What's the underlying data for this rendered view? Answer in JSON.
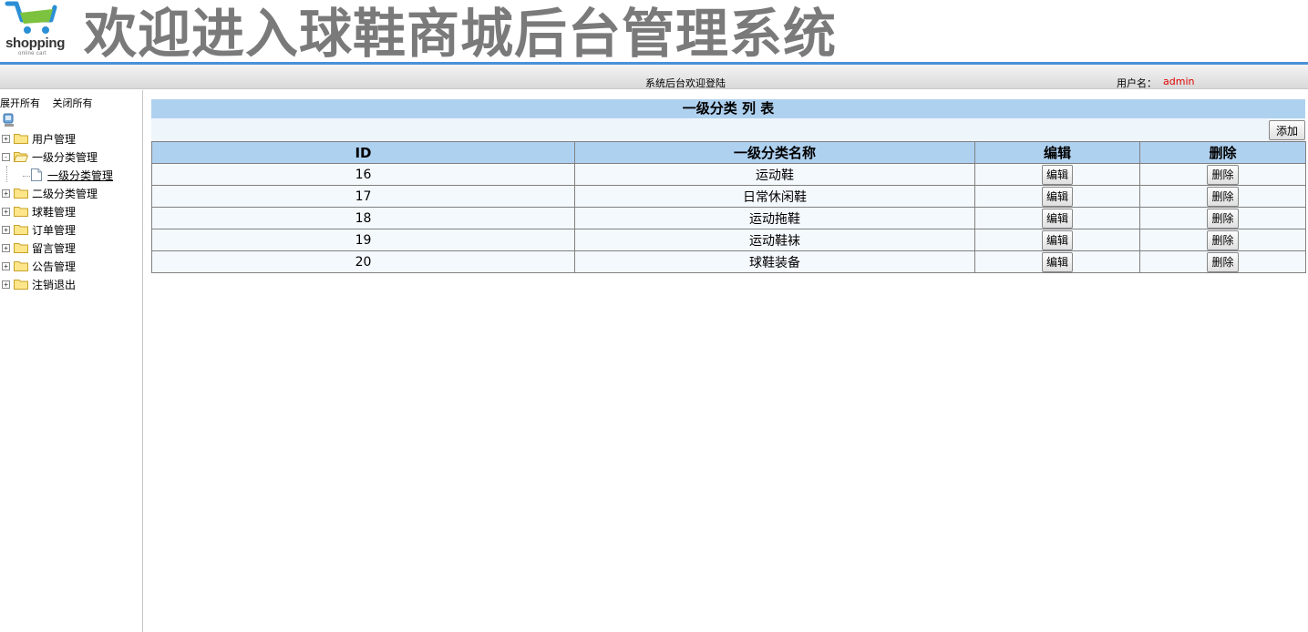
{
  "header": {
    "logo_word": "shopping",
    "logo_sub": "online cart",
    "title": "欢迎进入球鞋商城后台管理系统"
  },
  "statusbar": {
    "welcome": "系统后台欢迎登陆",
    "user_label": "用户名：",
    "user_value": "admin"
  },
  "sidebar": {
    "expand_all": "展开所有",
    "collapse_all": "关闭所有",
    "items": [
      {
        "label": "用户管理",
        "toggle": "+"
      },
      {
        "label": "一级分类管理",
        "toggle": "-"
      },
      {
        "label": "一级分类管理"
      },
      {
        "label": "二级分类管理",
        "toggle": "+"
      },
      {
        "label": "球鞋管理",
        "toggle": "+"
      },
      {
        "label": "订单管理",
        "toggle": "+"
      },
      {
        "label": "留言管理",
        "toggle": "+"
      },
      {
        "label": "公告管理",
        "toggle": "+"
      },
      {
        "label": "注销退出",
        "toggle": "+"
      }
    ]
  },
  "main": {
    "title": "一级分类 列 表",
    "add_label": "添加",
    "columns": [
      "ID",
      "一级分类名称",
      "编辑",
      "删除"
    ],
    "edit_label": "编辑",
    "delete_label": "删除",
    "rows": [
      {
        "id": "16",
        "name": "运动鞋"
      },
      {
        "id": "17",
        "name": "日常休闲鞋"
      },
      {
        "id": "18",
        "name": "运动拖鞋"
      },
      {
        "id": "19",
        "name": "运动鞋袜"
      },
      {
        "id": "20",
        "name": "球鞋装备"
      }
    ]
  },
  "colors": {
    "accent": "#4a90d9",
    "table_header": "#afd1f0",
    "username": "#e00000"
  }
}
